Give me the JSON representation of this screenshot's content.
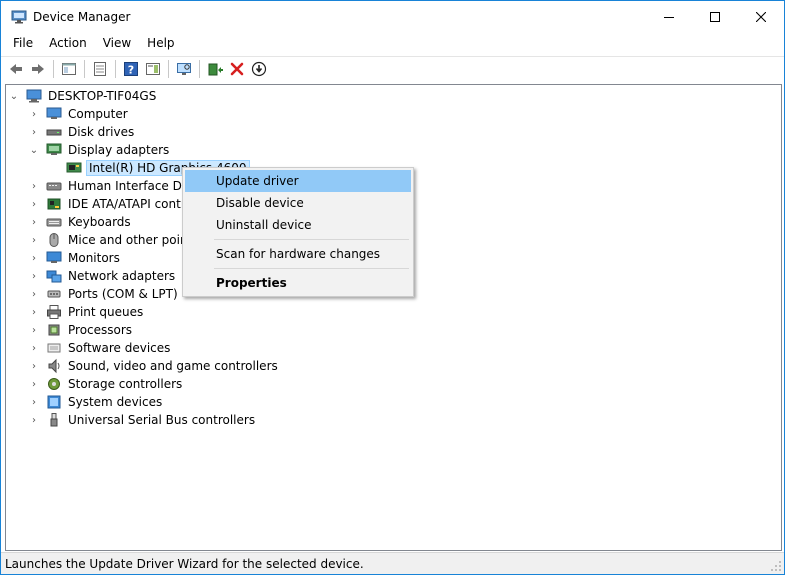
{
  "window": {
    "title": "Device Manager"
  },
  "menu": [
    "File",
    "Action",
    "View",
    "Help"
  ],
  "toolbar": {
    "icons": [
      "back-arrow-icon",
      "forward-arrow-icon",
      "show-hide-tree-icon",
      "properties-icon",
      "help-icon",
      "action-pane-icon",
      "monitor-scan-icon",
      "update-driver-icon",
      "uninstall-x-icon",
      "disable-device-icon"
    ]
  },
  "tree": {
    "root": "DESKTOP-TIF04GS",
    "items": [
      {
        "label": "Computer",
        "icon": "computer-icon"
      },
      {
        "label": "Disk drives",
        "icon": "disk-drive-icon"
      },
      {
        "label": "Display adapters",
        "icon": "display-adapter-icon",
        "expanded": true,
        "children": [
          {
            "label": "Intel(R) HD Graphics 4600",
            "icon": "graphics-card-icon",
            "selected": true
          }
        ]
      },
      {
        "label": "Human Interface Devices",
        "icon": "hid-icon"
      },
      {
        "label": "IDE ATA/ATAPI controllers",
        "icon": "ide-controller-icon"
      },
      {
        "label": "Keyboards",
        "icon": "keyboard-icon"
      },
      {
        "label": "Mice and other pointing devices",
        "icon": "mouse-icon"
      },
      {
        "label": "Monitors",
        "icon": "monitor-icon"
      },
      {
        "label": "Network adapters",
        "icon": "network-adapter-icon"
      },
      {
        "label": "Ports (COM & LPT)",
        "icon": "port-icon"
      },
      {
        "label": "Print queues",
        "icon": "printer-icon"
      },
      {
        "label": "Processors",
        "icon": "processor-icon"
      },
      {
        "label": "Software devices",
        "icon": "software-device-icon"
      },
      {
        "label": "Sound, video and game controllers",
        "icon": "speaker-icon"
      },
      {
        "label": "Storage controllers",
        "icon": "storage-controller-icon"
      },
      {
        "label": "System devices",
        "icon": "system-device-icon"
      },
      {
        "label": "Universal Serial Bus controllers",
        "icon": "usb-icon"
      }
    ]
  },
  "context_menu": {
    "items": [
      "Update driver",
      "Disable device",
      "Uninstall device",
      "Scan for hardware changes",
      "Properties"
    ],
    "highlighted": "Update driver",
    "bold": "Properties"
  },
  "status": {
    "text": "Launches the Update Driver Wizard for the selected device."
  },
  "colors": {
    "accent_border": "#1883d7",
    "selection": "#cce8ff",
    "menu_highlight": "#91c9f7"
  }
}
